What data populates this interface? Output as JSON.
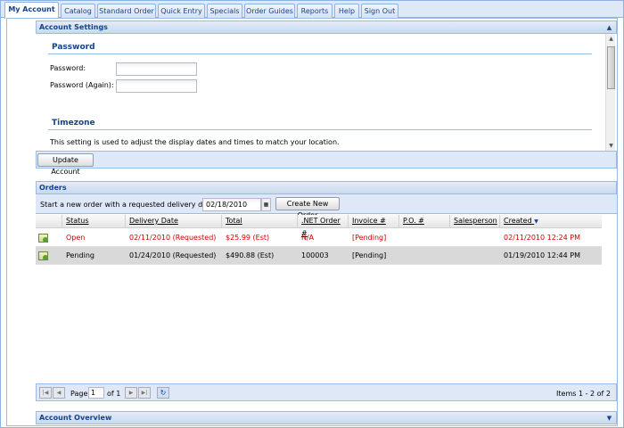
{
  "tabs": [
    {
      "label": "My Account",
      "active": true
    },
    {
      "label": "Catalog"
    },
    {
      "label": "Standard Order"
    },
    {
      "label": "Quick Entry"
    },
    {
      "label": "Specials"
    },
    {
      "label": "Order Guides"
    },
    {
      "label": "Reports"
    },
    {
      "label": "Help"
    },
    {
      "label": "Sign Out"
    }
  ],
  "account_settings": {
    "title": "Account Settings",
    "password_section": "Password",
    "password_label": "Password:",
    "password_again_label": "Password (Again):",
    "password_value": "",
    "password_again_value": "",
    "timezone_section": "Timezone",
    "timezone_desc": "This setting is used to adjust the display dates and times to match your location.",
    "update_button": "Update Account"
  },
  "orders": {
    "title": "Orders",
    "new_order_text": "Start a new order with a requested delivery date of",
    "delivery_date_value": "02/18/2010",
    "create_button": "Create New Order",
    "columns": [
      "Status",
      "Delivery Date",
      "Total",
      ".NET Order #",
      "Invoice #",
      "P.O. #",
      "Salesperson",
      "Created"
    ],
    "rows": [
      {
        "status": "Open",
        "delivery_date": "02/11/2010 (Requested)",
        "total": "$25.99 (Est)",
        "net_order": "N/A",
        "invoice": "[Pending]",
        "po": "",
        "salesperson": "",
        "created": "02/11/2010 12:24 PM",
        "highlight": true
      },
      {
        "status": "Pending",
        "delivery_date": "01/24/2010 (Requested)",
        "total": "$490.88 (Est)",
        "net_order": "100003",
        "invoice": "[Pending]",
        "po": "",
        "salesperson": "",
        "created": "01/19/2010 12:44 PM",
        "highlight": false
      }
    ],
    "pager": {
      "page_label": "Page",
      "page_value": "1",
      "of_label": "of 1",
      "items_text": "Items 1 - 2 of 2"
    }
  },
  "account_overview": {
    "title": "Account Overview"
  },
  "colors": {
    "accent": "#15428b",
    "highlight_text": "#cc0000",
    "panel_border": "#99bbe8"
  }
}
